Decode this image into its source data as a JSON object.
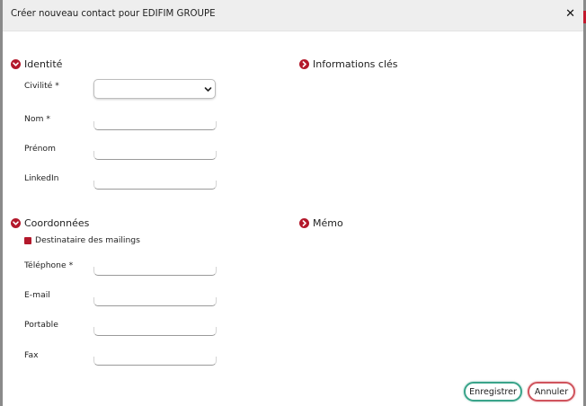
{
  "modal": {
    "title": "Créer nouveau contact pour EDIFIM GROUPE",
    "close_icon": "close-icon"
  },
  "identite": {
    "heading": "Identité",
    "fields": {
      "civilite": {
        "label": "Civilité *",
        "value": ""
      },
      "nom": {
        "label": "Nom *",
        "value": ""
      },
      "prenom": {
        "label": "Prénom",
        "value": ""
      },
      "linkedin": {
        "label": "LinkedIn",
        "value": ""
      }
    }
  },
  "informations": {
    "heading": "Informations clés"
  },
  "coordonnees": {
    "heading": "Coordonnées",
    "mailing_checkbox": {
      "label": "Destinataire des mailings",
      "checked": true
    },
    "fields": {
      "telephone": {
        "label": "Téléphone *",
        "value": ""
      },
      "email": {
        "label": "E-mail",
        "value": ""
      },
      "portable": {
        "label": "Portable",
        "value": ""
      },
      "fax": {
        "label": "Fax",
        "value": ""
      }
    }
  },
  "memo": {
    "heading": "Mémo"
  },
  "actions": {
    "save_label": "Enregistrer",
    "cancel_label": "Annuler"
  },
  "colors": {
    "accent": "#b3182b",
    "save_border": "#3aa48a",
    "cancel_border": "#d0545d",
    "titlebar": "#eeeeee"
  }
}
